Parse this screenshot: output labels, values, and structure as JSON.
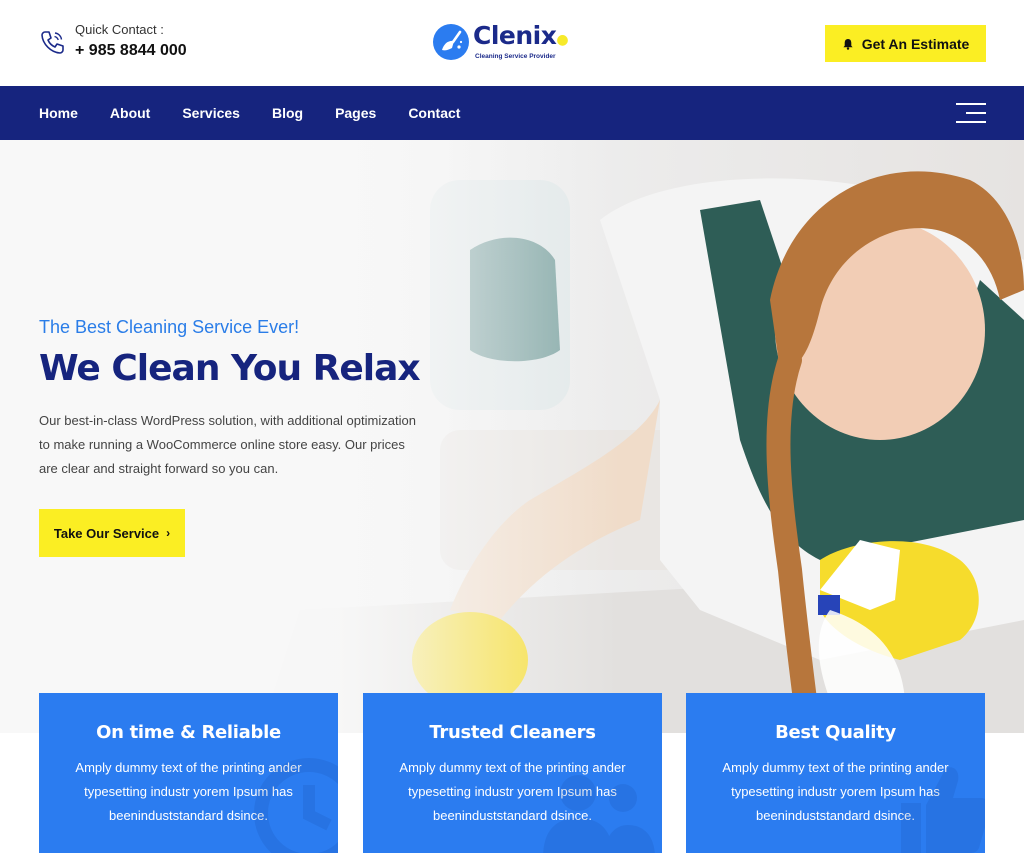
{
  "header": {
    "contact_label": "Quick Contact :",
    "contact_phone": "+ 985 8844 000",
    "logo_name": "Clenix",
    "logo_tagline": "Cleaning Service Provider",
    "estimate_label": "Get An Estimate"
  },
  "nav": {
    "items": [
      "Home",
      "About",
      "Services",
      "Blog",
      "Pages",
      "Contact"
    ]
  },
  "hero": {
    "subtitle": "The Best Cleaning Service Ever!",
    "title": "We Clean You Relax",
    "description": "Our best-in-class WordPress solution, with additional optimization to make running a WooCommerce online store easy. Our prices are clear and straight forward so you can.",
    "cta_label": "Take Our Service"
  },
  "features": [
    {
      "title": "On time & Reliable",
      "text": "Amply dummy text of the printing ander typesetting industr yorem Ipsum has beeninduststandard dsince.",
      "icon": "clock-icon"
    },
    {
      "title": "Trusted Cleaners",
      "text": "Amply dummy text of the printing ander typesetting industr yorem Ipsum has beeninduststandard dsince.",
      "icon": "users-icon"
    },
    {
      "title": "Best Quality",
      "text": "Amply dummy text of the printing ander typesetting industr yorem Ipsum has beeninduststandard dsince.",
      "icon": "thumbs-up-icon"
    }
  ],
  "colors": {
    "navy": "#16247e",
    "accent_yellow": "#fbee23",
    "card_blue": "#2b7cf0",
    "subtitle_blue": "#2a7de8"
  }
}
